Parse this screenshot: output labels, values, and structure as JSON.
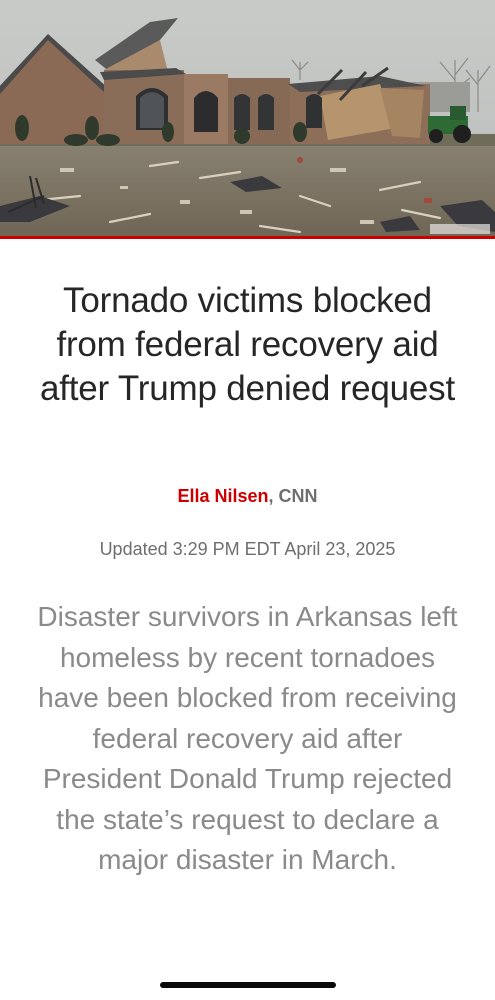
{
  "article": {
    "headline": "Tornado victims blocked from federal recovery aid after Trump denied request",
    "author": "Ella Nilsen",
    "separator": ", ",
    "source": "CNN",
    "updated": "Updated 3:29 PM EDT April 23, 2025",
    "lede": "Disaster survivors in Arkansas left homeless by recent tornadoes have been blocked from receiving federal recovery aid after President Donald Trump rejected the state’s request to declare a major disaster in March."
  },
  "hero_image": {
    "subject": "tornado-damaged brick house with debris-covered yard"
  },
  "colors": {
    "accent": "#cc0000",
    "headline": "#262626",
    "meta": "#6e6e6e",
    "lede": "#8a8a8a",
    "home_indicator": "#0a0a0a"
  }
}
